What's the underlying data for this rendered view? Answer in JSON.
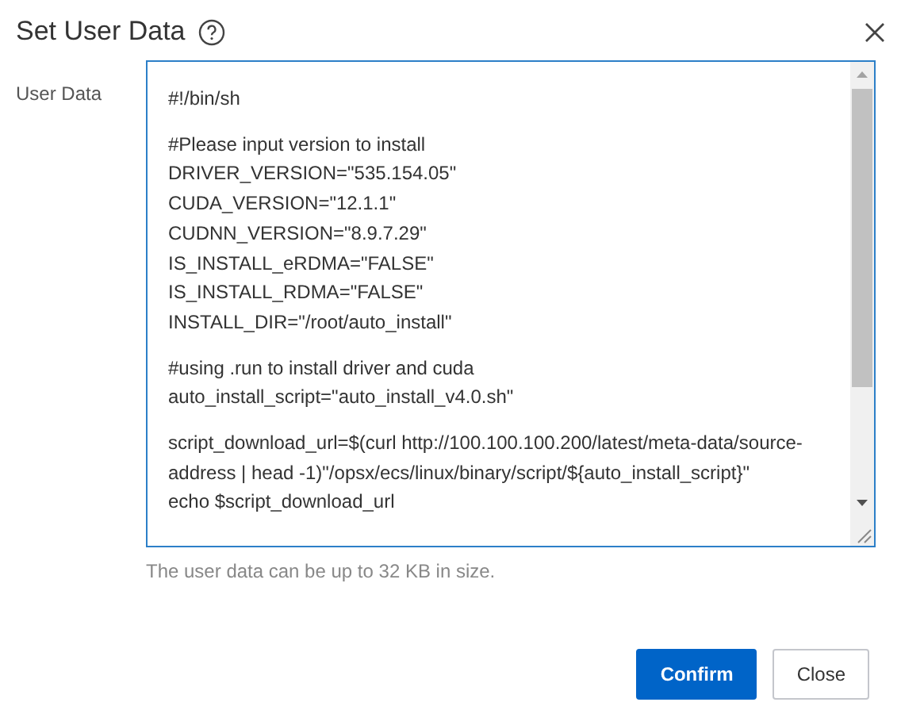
{
  "dialog": {
    "title": "Set User Data"
  },
  "field": {
    "label": "User Data",
    "blocks": [
      [
        "#!/bin/sh"
      ],
      [
        "#Please input version to install",
        "DRIVER_VERSION=\"535.154.05\"",
        "CUDA_VERSION=\"12.1.1\"",
        "CUDNN_VERSION=\"8.9.7.29\"",
        "IS_INSTALL_eRDMA=\"FALSE\"",
        "IS_INSTALL_RDMA=\"FALSE\"",
        "INSTALL_DIR=\"/root/auto_install\""
      ],
      [
        "#using .run to install driver and cuda",
        "auto_install_script=\"auto_install_v4.0.sh\""
      ],
      [
        "script_download_url=$(curl http://100.100.100.200/latest/meta-data/source-",
        "address | head -1)\"/opsx/ecs/linux/binary/script/${auto_install_script}\"",
        "echo $script_download_url"
      ]
    ],
    "hint": "The user data can be up to 32 KB in size."
  },
  "buttons": [
    {
      "label": "Confirm",
      "kind": "primary"
    },
    {
      "label": "Close",
      "kind": "secondary"
    }
  ]
}
